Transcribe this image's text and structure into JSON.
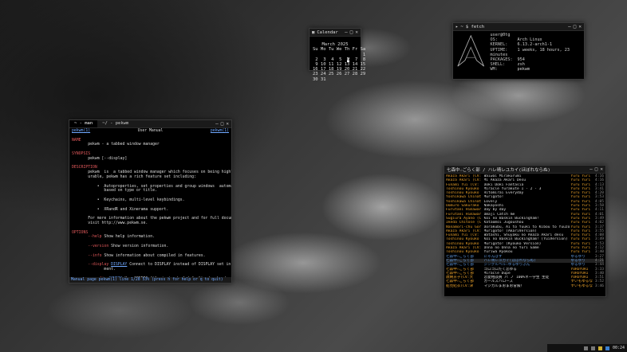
{
  "calendar": {
    "title": "Calendar",
    "month": "March 2025",
    "weekdays": "Su Mo Tu We Th Fr Sa",
    "weeks": [
      "                   1",
      " 2  3  4  5  6  7  8",
      " 9 10 11 12 13 14 15",
      "16 17 18 19 20 21 22",
      "23 24 25 26 27 28 29",
      "30 31"
    ],
    "today": "6"
  },
  "fetch": {
    "title": "~ $ fetch",
    "user": "user@0tg",
    "rows": [
      {
        "k": "OS:",
        "v": "Arch Linux"
      },
      {
        "k": "KERNEL:",
        "v": "6.13.2-arch1-1"
      },
      {
        "k": "UPTIME:",
        "v": "1 weeks, 18 hours, 23 minutes"
      },
      {
        "k": "PACKAGES:",
        "v": "954"
      },
      {
        "k": "SHELL:",
        "v": "zsh"
      },
      {
        "k": "WM:",
        "v": "pekwm"
      }
    ]
  },
  "man": {
    "tabs": [
      "~ - man",
      "~/ - pekwm"
    ],
    "header_left": "pekwm(1)",
    "header_center": "User Manual",
    "header_right": "pekwm(1)",
    "status": "Manual page pekwm(1) line 1/28 53% (press h for help or q to quit)"
  },
  "playlist": {
    "title": "七森中☆ごらく部 / ハレ晴レユカイ(ほぼれならぬ)",
    "rows": [
      {
        "a": "Akaza Akari (CV:",
        "t": "Waiwai Mirakurumi",
        "al": "Yuru Yuri",
        "d": "4:16"
      },
      {
        "a": "Akaza Akari (CV:",
        "t": "Mi Akaza Akari Desu",
        "al": "Yuru Yuri",
        "d": "4:16"
      },
      {
        "a": "Funami Yui (CV:",
        "t": "Doki Doki Fantasia",
        "al": "Yuru Yuri",
        "d": "4:13"
      },
      {
        "a": "Toshinou Kyouko",
        "t": "Miracle Yurakute 1 - 2 - 3",
        "al": "Yuru Yuri",
        "d": "3:41"
      },
      {
        "a": "Toshinou Kyouko",
        "t": "Hitomirai Everyday",
        "al": "Yuru Yuri",
        "d": "4:20"
      },
      {
        "a": "Yoshikawa Chinat",
        "t": "Murigoto!",
        "al": "Yuru Yuri",
        "d": "3:53"
      },
      {
        "a": "Yoshikawa Chinat",
        "t": "Lovely",
        "al": "Yuru Yuri",
        "d": "4:05"
      },
      {
        "a": "Oomuro Sakurako",
        "t": "Nakayoshi",
        "al": "Yuru Yuri",
        "d": "3:58"
      },
      {
        "a": "Furutani Himawar",
        "t": "Day by day",
        "al": "Yuru Yuri",
        "d": "4:11"
      },
      {
        "a": "Furutani Himawar",
        "t": "Omaji Catch me",
        "al": "Yuru Yuri",
        "d": "4:01"
      },
      {
        "a": "Sugiura Ayano (C",
        "t": "Koi no Baskin Buckingham!",
        "al": "Yuru Yuri",
        "d": "3:49"
      },
      {
        "a": "Ikeda Chitose (C",
        "t": "Kataomoi Jugoushou",
        "al": "Yuru Yuri",
        "d": "4:02"
      },
      {
        "a": "Nanamori-chu Gor",
        "t": "Dorakubu, Ai to Yuuki to Kibou to Yuuzo",
        "al": "Yuru Yuri",
        "d": "3:37"
      },
      {
        "a": "Akaza Akari (CV:",
        "t": "Murigoto! (AkariVersion)",
        "al": "Yuru Yuri",
        "d": "3:55"
      },
      {
        "a": "Funami Yui (CV:",
        "t": "Watashi, Shuyaku no Akaza Akari desu",
        "al": "Yuru Yuri",
        "d": "4:08"
      },
      {
        "a": "Toshinou Kyouko",
        "t": "Koi no Baskin Buckingham! (YuiVersion)",
        "al": "Yuru Yuri",
        "d": "3:49"
      },
      {
        "a": "Toshinou Kyouko",
        "t": "Murigoto! (Kyouko Version)",
        "al": "Yuru Yuri",
        "d": "3:53"
      },
      {
        "a": "Akaza Akari (CV:",
        "t": "Onna no Onna no Yuri Game",
        "al": "Yuru Yuri",
        "d": "4:12"
      },
      {
        "a": "Toshinou Kyouko",
        "t": "Yuriwa Ryokou",
        "al": "Yuru Yuri",
        "d": "3:40"
      },
      {
        "a": "七森中☆ごらく部",
        "t": "にゃんぱす",
        "al": "ゆるゆり",
        "d": "3:27",
        "blue": true
      },
      {
        "a": "七森中☆ごらく部",
        "t": "ハレ晴レユカイ(ほぼれならぬ)",
        "al": "ゆるゆり",
        "d": "4:21",
        "blue": true,
        "sel": true
      },
      {
        "a": "七森中☆ごらく部",
        "t": "ジングルベル☆ゆるゆりぷん",
        "al": "ゆるゆり",
        "d": "3:44",
        "blue": true
      },
      {
        "a": "七森中☆ごらく部",
        "t": "ゴロゴロだく恋ゆる",
        "al": "YURUYURI",
        "d": "3:33"
      },
      {
        "a": "七森中☆ごらく部",
        "t": "Miracle Dupe",
        "al": "YURUYURI",
        "d": "3:40"
      },
      {
        "a": "歳納京子(CV:大",
        "t": "恋愛相談員 パ ノ 100%ネー学生 生徒",
        "al": "YURUYURI",
        "d": "3:51"
      },
      {
        "a": "七森中☆ごらく部",
        "t": "ガールズバローズ",
        "al": "すいもゆるなら",
        "d": "3:52"
      },
      {
        "a": "船見結衣(CV:津",
        "t": "マジカルまおまお冒険！",
        "al": "すいもゆるなら",
        "d": "3:46"
      }
    ]
  },
  "tray": {
    "clock": "00:24"
  }
}
